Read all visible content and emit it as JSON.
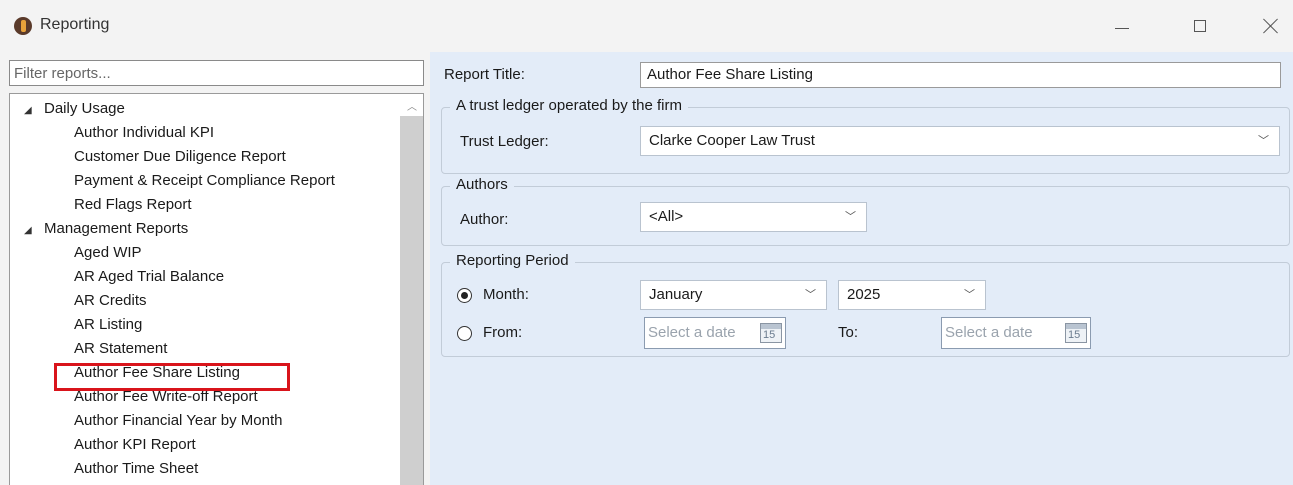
{
  "window": {
    "title": "Reporting"
  },
  "filter": {
    "placeholder": "Filter reports..."
  },
  "tree": {
    "groups": [
      {
        "label": "Daily Usage",
        "items": [
          "Author Individual KPI",
          "Customer Due Diligence Report",
          "Payment & Receipt Compliance Report",
          "Red Flags Report"
        ]
      },
      {
        "label": "Management Reports",
        "items": [
          "Aged WIP",
          "AR Aged Trial Balance",
          "AR Credits",
          "AR Listing",
          "AR Statement",
          "Author Fee Share Listing",
          "Author Fee Write-off Report",
          "Author Financial Year by Month",
          "Author KPI Report",
          "Author Time Sheet"
        ]
      }
    ],
    "selected": "Author Fee Share Listing"
  },
  "form": {
    "report_title_label": "Report Title:",
    "report_title_value": "Author Fee Share Listing",
    "trust_group_title": "A trust ledger operated by the firm",
    "trust_label": "Trust Ledger:",
    "trust_value": "Clarke Cooper Law Trust",
    "authors_group_title": "Authors",
    "author_label": "Author:",
    "author_value": "<All>",
    "period_group_title": "Reporting Period",
    "month_label": "Month:",
    "month_value": "January",
    "year_value": "2025",
    "from_label": "From:",
    "to_label": "To:",
    "date_placeholder": "Select a date",
    "calendar_day": "15"
  },
  "icons": {
    "app": "reporting-app-icon",
    "minimize": "minimize-icon",
    "maximize": "maximize-icon",
    "close": "close-icon",
    "calendar": "calendar-icon"
  }
}
